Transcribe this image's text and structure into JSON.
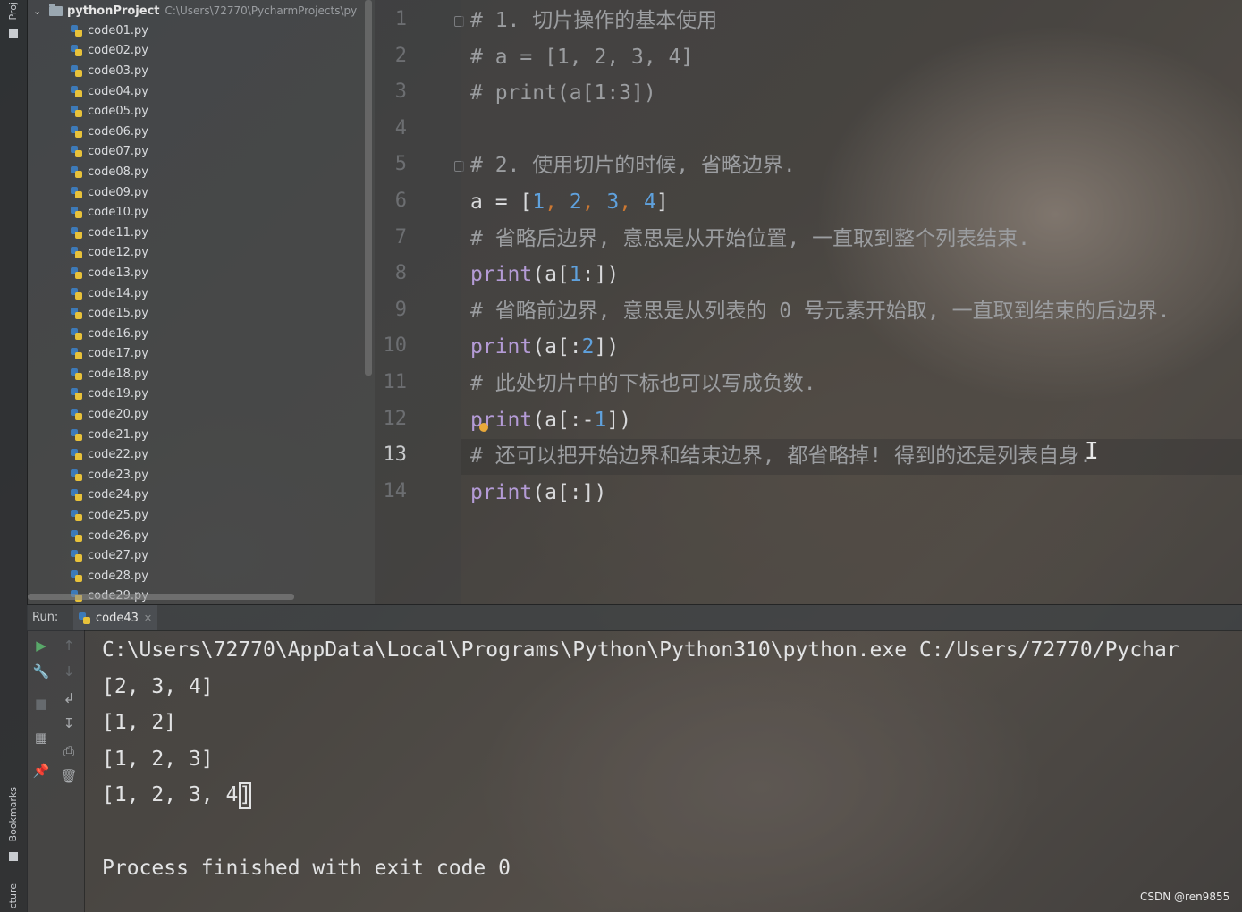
{
  "side_tabs": {
    "project": "Proj",
    "bookmarks": "Bookmarks",
    "structure": "cture"
  },
  "project": {
    "root_name": "pythonProject",
    "root_path": "C:\\Users\\72770\\PycharmProjects\\py",
    "files": [
      "code01.py",
      "code02.py",
      "code03.py",
      "code04.py",
      "code05.py",
      "code06.py",
      "code07.py",
      "code08.py",
      "code09.py",
      "code10.py",
      "code11.py",
      "code12.py",
      "code13.py",
      "code14.py",
      "code15.py",
      "code16.py",
      "code17.py",
      "code18.py",
      "code19.py",
      "code20.py",
      "code21.py",
      "code22.py",
      "code23.py",
      "code24.py",
      "code25.py",
      "code26.py",
      "code27.py",
      "code28.py",
      "code29.py"
    ]
  },
  "editor": {
    "current_line": 13,
    "line_numbers": [
      "1",
      "2",
      "3",
      "4",
      "5",
      "6",
      "7",
      "8",
      "9",
      "10",
      "11",
      "12",
      "13",
      "14"
    ],
    "lines": [
      "# 1. 切片操作的基本使用",
      "# a = [1, 2, 3, 4]",
      "# print(a[1:3])",
      "",
      "# 2. 使用切片的时候, 省略边界.",
      "a = [1, 2, 3, 4]",
      "# 省略后边界, 意思是从开始位置, 一直取到整个列表结束.",
      "print(a[1:])",
      "# 省略前边界, 意思是从列表的 0 号元素开始取, 一直取到结束的后边界.",
      "print(a[:2])",
      "# 此处切片中的下标也可以写成负数.",
      "print(a[:-1])",
      "# 还可以把开始边界和结束边界, 都省略掉! 得到的还是列表自身.",
      "print(a[:])"
    ]
  },
  "run": {
    "label": "Run:",
    "tab_name": "code43",
    "output": [
      "C:\\Users\\72770\\AppData\\Local\\Programs\\Python\\Python310\\python.exe C:/Users/72770/Pychar",
      "[2, 3, 4]",
      "[1, 2]",
      "[1, 2, 3]",
      "[1, 2, 3, 4",
      "",
      "Process finished with exit code 0"
    ],
    "caret_char": "]"
  },
  "watermark": "CSDN @ren9855",
  "icons": {
    "run": "play-icon",
    "up": "arrow-up-icon",
    "wrench": "wrench-icon",
    "down": "arrow-down-icon",
    "wrap": "soft-wrap-icon",
    "stop": "stop-icon",
    "scroll_end": "scroll-to-end-icon",
    "layout": "layout-icon",
    "print": "print-icon",
    "pin": "pin-icon",
    "trash": "trash-icon"
  },
  "colors": {
    "keyword_fn": "#b49bd6",
    "number": "#5fa1dd",
    "comma": "#cc7832",
    "comment": "#9b9da0"
  }
}
